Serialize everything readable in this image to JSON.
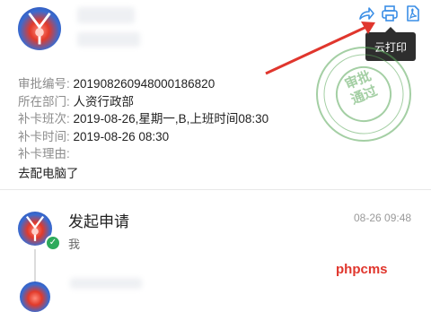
{
  "header": {
    "icons": [
      "forward-icon",
      "print-icon",
      "pdf-icon"
    ],
    "tooltip": "云打印"
  },
  "details": {
    "rows": [
      {
        "label": "审批编号:",
        "value": "20190826094800018682​0"
      },
      {
        "label": "所在部门:",
        "value": "人资行政部"
      },
      {
        "label": "补卡班次:",
        "value": "2019-08-26,星期一,B,上班时间08:30"
      },
      {
        "label": "补卡时间:",
        "value": "2019-08-26 08:30"
      },
      {
        "label": "补卡理由:",
        "value": ""
      }
    ],
    "reason": "去配电脑了"
  },
  "stamp": {
    "line1": "审批",
    "line2": "通过",
    "color": "#5aa85a"
  },
  "timeline": {
    "step_title": "发起申请",
    "step_user": "我",
    "step_time": "08-26 09:48",
    "status_color": "#2eaa5c"
  },
  "watermark": "phpcms",
  "colors": {
    "icon_blue": "#3a8ee6",
    "arrow_red": "#e0362d"
  }
}
